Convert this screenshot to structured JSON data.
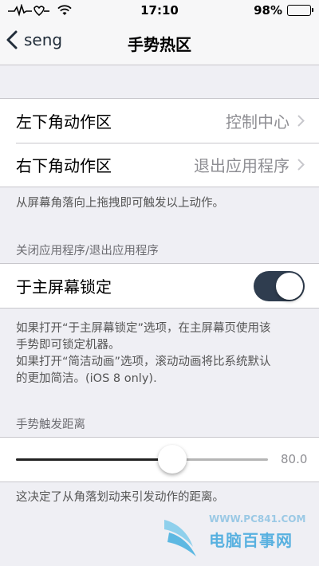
{
  "status_bar": {
    "time": "17:10",
    "battery": "98%",
    "battery_level": 0.98
  },
  "nav": {
    "back_label": "seng",
    "title": "手势热区"
  },
  "corner_actions": [
    {
      "label": "左下角动作区",
      "value": "控制中心"
    },
    {
      "label": "右下角动作区",
      "value": "退出应用程序"
    }
  ],
  "corner_footer": "从屏幕角落向上拖拽即可触发以上动作。",
  "lock_section": {
    "header": "关闭应用程序/退出应用程序",
    "toggle_label": "于主屏幕锁定",
    "toggle_on": true,
    "footer_line1": "如果打开“于主屏幕锁定”选项，在主屏幕页使用该",
    "footer_line2": "手势即可锁定机器。",
    "footer_line3": "如果打开“简洁动画”选项，滚动动画将比系统默认",
    "footer_line4": "的更加简洁。(iOS 8 only)."
  },
  "distance_section": {
    "header": "手势触发距离",
    "slider_fraction": 0.62,
    "value_text": "80.0",
    "footer": "这决定了从角落划动来引发动作的距离。"
  },
  "watermark": {
    "url": "WWW.PC841.COM",
    "name": "电脑百事网"
  },
  "colors": {
    "accent": "#2f3d4f",
    "background": "#efeff4"
  }
}
